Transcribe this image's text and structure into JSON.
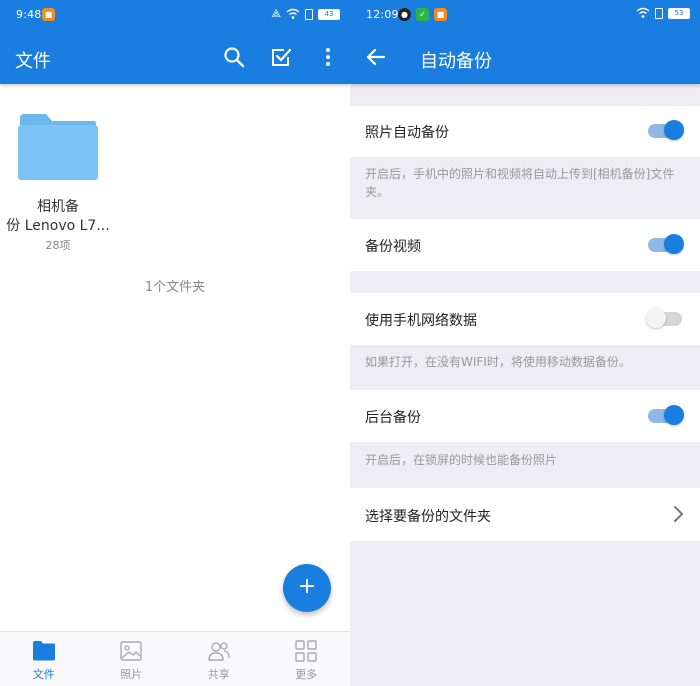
{
  "left": {
    "status": {
      "time": "9:48",
      "battery": "43"
    },
    "appbar": {
      "title": "文件"
    },
    "folder": {
      "name_line1": "相机备",
      "name_line2": "份 Lenovo L7...",
      "count": "28项"
    },
    "summary": "1个文件夹",
    "fab": {
      "label": "+"
    },
    "nav": [
      {
        "label": "文件",
        "icon": "folder-icon",
        "active": true
      },
      {
        "label": "照片",
        "icon": "image-icon",
        "active": false
      },
      {
        "label": "共享",
        "icon": "people-icon",
        "active": false
      },
      {
        "label": "更多",
        "icon": "grid-icon",
        "active": false
      }
    ]
  },
  "right": {
    "status": {
      "time": "12:09",
      "battery": "53"
    },
    "appbar": {
      "title": "自动备份"
    },
    "settings": {
      "photo_backup": {
        "label": "照片自动备份",
        "enabled": true,
        "desc": "开启后，手机中的照片和视频将自动上传到[相机备份]文件夹。"
      },
      "video_backup": {
        "label": "备份视频",
        "enabled": true
      },
      "mobile_data": {
        "label": "使用手机网络数据",
        "enabled": false,
        "desc": "如果打开，在没有WIFI时，将使用移动数据备份。"
      },
      "background_backup": {
        "label": "后台备份",
        "enabled": true,
        "desc": "开启后，在锁屏的时候也能备份照片"
      },
      "choose_folder": {
        "label": "选择要备份的文件夹"
      }
    }
  },
  "colors": {
    "primary": "#1a7ee0",
    "folder": "#7cc4f5",
    "toggle_on_track": "#8fb8e6",
    "settings_bg": "#ededf3"
  }
}
